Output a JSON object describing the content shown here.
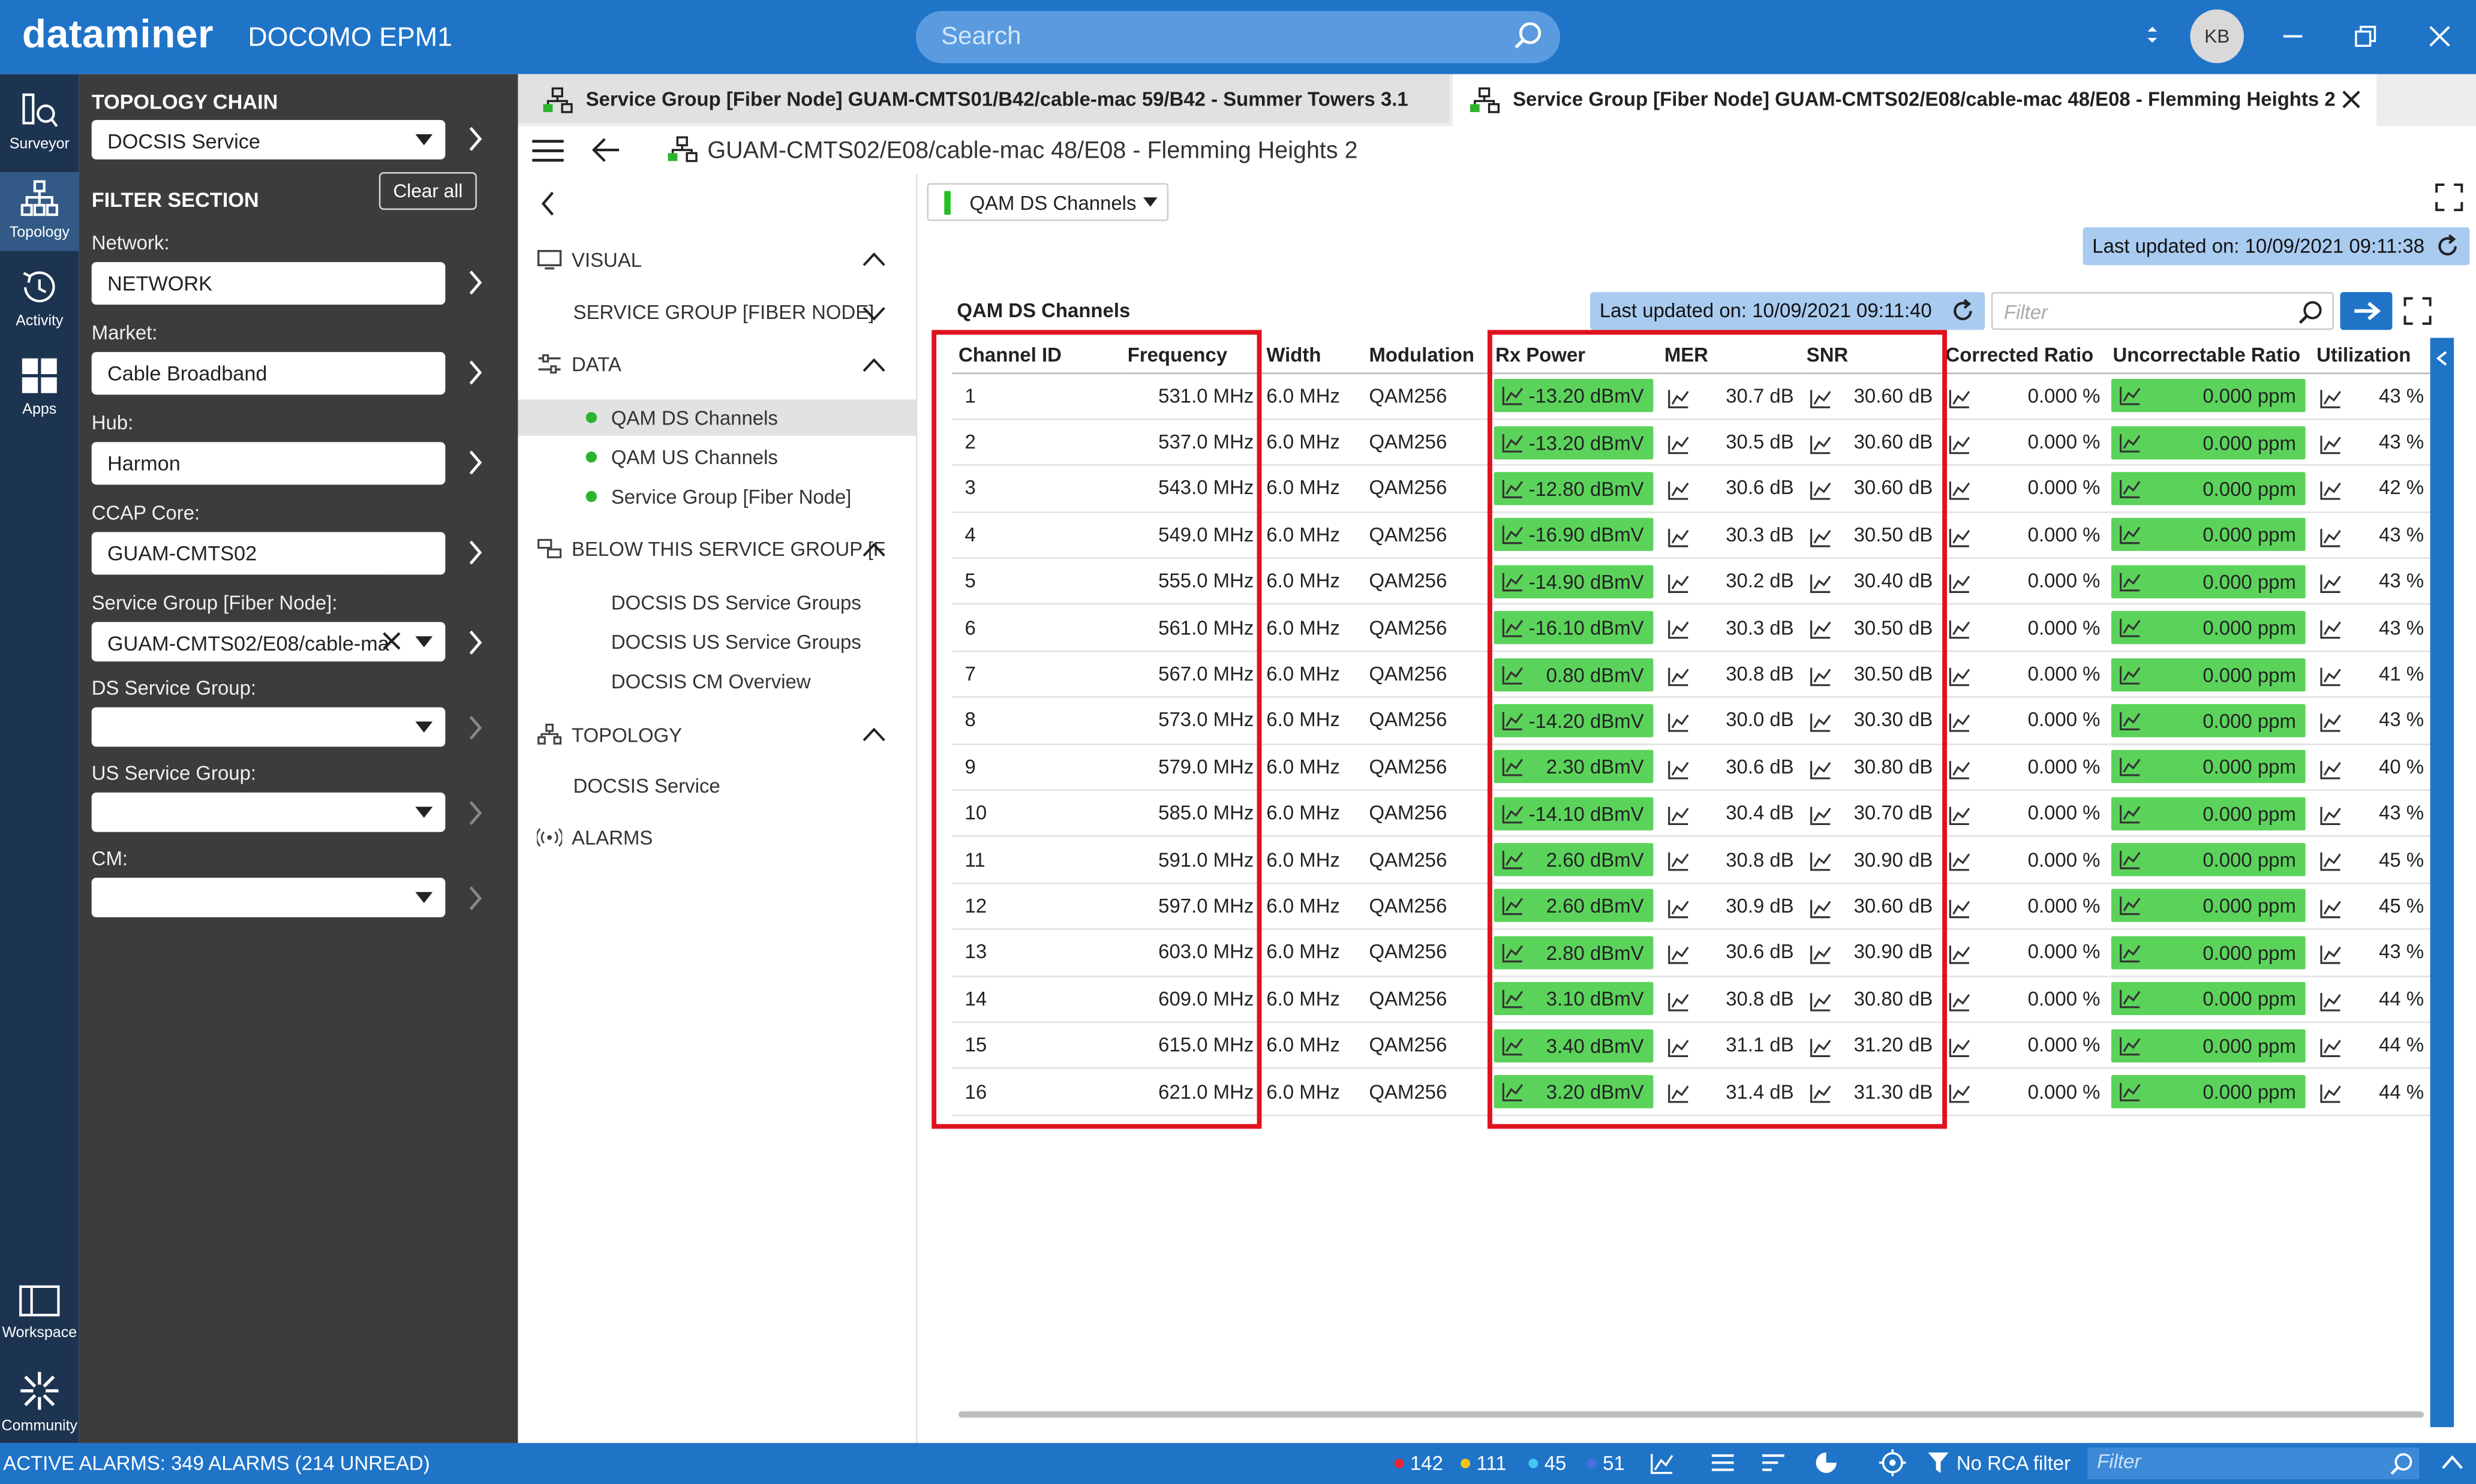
{
  "app": {
    "brand": "dataminer",
    "system_name": "DOCOMO EPM1",
    "search_placeholder": "Search",
    "user_initials": "KB"
  },
  "left_nav": {
    "items": [
      {
        "label": "Surveyor",
        "icon": "surveyor-icon"
      },
      {
        "label": "Topology",
        "icon": "topology-icon"
      },
      {
        "label": "Activity",
        "icon": "activity-icon"
      },
      {
        "label": "Apps",
        "icon": "apps-icon"
      },
      {
        "label": "Workspace",
        "icon": "workspace-icon"
      },
      {
        "label": "Community",
        "icon": "community-icon"
      }
    ]
  },
  "filter_panel": {
    "topology_chain_title": "TOPOLOGY CHAIN",
    "topology_chain_value": "DOCSIS Service",
    "filter_section_title": "FILTER SECTION",
    "clear_all": "Clear all",
    "fields": [
      {
        "label": "Network:",
        "value": "NETWORK"
      },
      {
        "label": "Market:",
        "value": "Cable Broadband"
      },
      {
        "label": "Hub:",
        "value": "Harmon"
      },
      {
        "label": "CCAP Core:",
        "value": "GUAM-CMTS02"
      },
      {
        "label": "Service Group [Fiber Node]:",
        "value": "GUAM-CMTS02/E08/cable-ma"
      },
      {
        "label": "DS Service Group:",
        "value": ""
      },
      {
        "label": "US Service Group:",
        "value": ""
      },
      {
        "label": "CM:",
        "value": ""
      }
    ]
  },
  "tabs": [
    {
      "label": "Service Group [Fiber Node] GUAM-CMTS01/B42/cable-mac 59/B42 - Summer Towers 3.1"
    },
    {
      "label": "Service Group [Fiber Node] GUAM-CMTS02/E08/cable-mac 48/E08 - Flemming Heights 2"
    }
  ],
  "breadcrumb": "GUAM-CMTS02/E08/cable-mac 48/E08 - Flemming Heights 2",
  "tree": {
    "visual": "VISUAL",
    "visual_child": "SERVICE GROUP [FIBER NODE]",
    "data": "DATA",
    "data_items": [
      "QAM DS Channels",
      "QAM US Channels",
      "Service Group [Fiber Node]"
    ],
    "below": "BELOW THIS SERVICE GROUP [F",
    "below_items": [
      "DOCSIS DS Service Groups",
      "DOCSIS US Service Groups",
      "DOCSIS CM Overview"
    ],
    "topology": "TOPOLOGY",
    "topology_items": [
      "DOCSIS Service"
    ],
    "alarms": "ALARMS"
  },
  "main": {
    "dropdown": "QAM DS Channels",
    "last_updated_top": "Last updated on: 10/09/2021 09:11:38",
    "last_updated_table": "Last updated on: 10/09/2021 09:11:40",
    "table_title": "QAM DS Channels",
    "filter_placeholder": "Filter",
    "columns": [
      "Channel ID",
      "Frequency",
      "Width",
      "Modulation",
      "Rx Power",
      "MER",
      "SNR",
      "Corrected Ratio",
      "Uncorrectable Ratio",
      "Utilization"
    ],
    "rows": [
      [
        "1",
        "531.0 MHz",
        "6.0 MHz",
        "QAM256",
        "-13.20 dBmV",
        "30.7 dB",
        "30.60 dB",
        "0.000 %",
        "0.000 ppm",
        "43 %"
      ],
      [
        "2",
        "537.0 MHz",
        "6.0 MHz",
        "QAM256",
        "-13.20 dBmV",
        "30.5 dB",
        "30.60 dB",
        "0.000 %",
        "0.000 ppm",
        "43 %"
      ],
      [
        "3",
        "543.0 MHz",
        "6.0 MHz",
        "QAM256",
        "-12.80 dBmV",
        "30.6 dB",
        "30.60 dB",
        "0.000 %",
        "0.000 ppm",
        "42 %"
      ],
      [
        "4",
        "549.0 MHz",
        "6.0 MHz",
        "QAM256",
        "-16.90 dBmV",
        "30.3 dB",
        "30.50 dB",
        "0.000 %",
        "0.000 ppm",
        "43 %"
      ],
      [
        "5",
        "555.0 MHz",
        "6.0 MHz",
        "QAM256",
        "-14.90 dBmV",
        "30.2 dB",
        "30.40 dB",
        "0.000 %",
        "0.000 ppm",
        "43 %"
      ],
      [
        "6",
        "561.0 MHz",
        "6.0 MHz",
        "QAM256",
        "-16.10 dBmV",
        "30.3 dB",
        "30.50 dB",
        "0.000 %",
        "0.000 ppm",
        "43 %"
      ],
      [
        "7",
        "567.0 MHz",
        "6.0 MHz",
        "QAM256",
        "0.80 dBmV",
        "30.8 dB",
        "30.50 dB",
        "0.000 %",
        "0.000 ppm",
        "41 %"
      ],
      [
        "8",
        "573.0 MHz",
        "6.0 MHz",
        "QAM256",
        "-14.20 dBmV",
        "30.0 dB",
        "30.30 dB",
        "0.000 %",
        "0.000 ppm",
        "43 %"
      ],
      [
        "9",
        "579.0 MHz",
        "6.0 MHz",
        "QAM256",
        "2.30 dBmV",
        "30.6 dB",
        "30.80 dB",
        "0.000 %",
        "0.000 ppm",
        "40 %"
      ],
      [
        "10",
        "585.0 MHz",
        "6.0 MHz",
        "QAM256",
        "-14.10 dBmV",
        "30.4 dB",
        "30.70 dB",
        "0.000 %",
        "0.000 ppm",
        "43 %"
      ],
      [
        "11",
        "591.0 MHz",
        "6.0 MHz",
        "QAM256",
        "2.60 dBmV",
        "30.8 dB",
        "30.90 dB",
        "0.000 %",
        "0.000 ppm",
        "45 %"
      ],
      [
        "12",
        "597.0 MHz",
        "6.0 MHz",
        "QAM256",
        "2.60 dBmV",
        "30.9 dB",
        "30.60 dB",
        "0.000 %",
        "0.000 ppm",
        "45 %"
      ],
      [
        "13",
        "603.0 MHz",
        "6.0 MHz",
        "QAM256",
        "2.80 dBmV",
        "30.6 dB",
        "30.90 dB",
        "0.000 %",
        "0.000 ppm",
        "43 %"
      ],
      [
        "14",
        "609.0 MHz",
        "6.0 MHz",
        "QAM256",
        "3.10 dBmV",
        "30.8 dB",
        "30.80 dB",
        "0.000 %",
        "0.000 ppm",
        "44 %"
      ],
      [
        "15",
        "615.0 MHz",
        "6.0 MHz",
        "QAM256",
        "3.40 dBmV",
        "31.1 dB",
        "31.20 dB",
        "0.000 %",
        "0.000 ppm",
        "44 %"
      ],
      [
        "16",
        "621.0 MHz",
        "6.0 MHz",
        "QAM256",
        "3.20 dBmV",
        "31.4 dB",
        "31.30 dB",
        "0.000 %",
        "0.000 ppm",
        "44 %"
      ]
    ]
  },
  "status_bar": {
    "alarms_text": "ACTIVE ALARMS: 349 ALARMS (214 UNREAD)",
    "counts": [
      {
        "value": "142",
        "color": "#e8252e"
      },
      {
        "value": "111",
        "color": "#f5c518"
      },
      {
        "value": "45",
        "color": "#42c8f5"
      },
      {
        "value": "51",
        "color": "#4a6ee0"
      }
    ],
    "rca_filter": "No RCA filter",
    "filter_placeholder": "Filter"
  },
  "colors": {
    "accent": "#1f74c8",
    "nav_bg": "#1d3450",
    "panel_bg": "#3c3c3c",
    "ok_green": "#5bd35b",
    "highlight_red": "#e0121e"
  }
}
